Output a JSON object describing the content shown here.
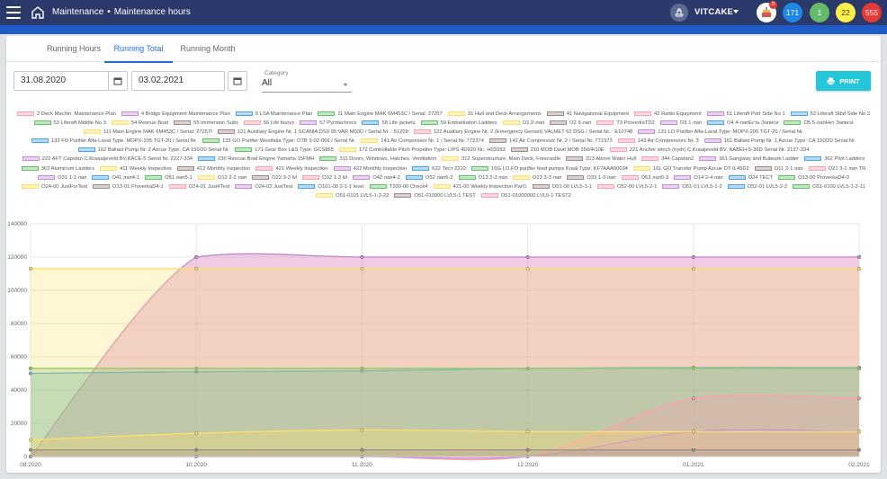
{
  "header": {
    "breadcrumb_section": "Maintenance",
    "breadcrumb_separator": "•",
    "breadcrumb_page": "Maintenance hours",
    "username": "VITCAKE",
    "notification_count": "0",
    "badge_blue": "171",
    "badge_green": "1",
    "badge_yellow": "22",
    "badge_red": "555"
  },
  "tabs": [
    "Running Hours",
    "Running Total",
    "Running Month"
  ],
  "active_tab": "Running Total",
  "filters": {
    "date_from": "31.08.2020",
    "date_to": "03.02.2021",
    "category_label": "Category",
    "category_value": "All",
    "print_label": "PRINT"
  },
  "colors": {
    "topbar": "#2b3a6b",
    "accent": "#1e6fd0",
    "print": "#26c6da"
  },
  "chart_data": {
    "type": "area",
    "x": [
      "08.2020",
      "10.2020",
      "11.2020",
      "12.2020",
      "01.2021",
      "02.2021"
    ],
    "ylim": [
      0,
      140000
    ],
    "yticks": [
      0,
      20000,
      40000,
      60000,
      80000,
      100000,
      120000,
      140000
    ],
    "grid": true,
    "legend_position": "top",
    "series_values": [
      {
        "name": "2 Deck Machin. Maintenance Plan",
        "color": "#ff9fb0",
        "values": [
          0,
          120000,
          120000,
          120000,
          120000,
          120000
        ]
      },
      {
        "name": "4 Bridge Equipment Maintenance Plan",
        "color": "#c58fd6",
        "values": [
          0,
          120000,
          120000,
          120000,
          120000,
          120000
        ]
      },
      {
        "name": "5 LSA Maintenance Plan",
        "color": "#4aa3f0",
        "values": [
          50000,
          51000,
          51500,
          53000,
          53500,
          53500
        ]
      },
      {
        "name": "11 Main Engine MAK 6M453C / Serial: 27257",
        "color": "#66c26a",
        "values": [
          53000,
          53000,
          53000,
          53000,
          53000,
          53000
        ]
      },
      {
        "name": "31 Hull and Deck Arrangements",
        "color": "#ffe066",
        "values": [
          113000,
          113000,
          113000,
          113000,
          113000,
          113000
        ]
      },
      {
        "name": "42 Radio Equipment",
        "color": "#ff9fb0",
        "values": [
          0,
          0,
          0,
          0,
          35000,
          35000
        ]
      },
      {
        "name": "51 Liferaft Port Side No 1",
        "color": "#c58fd6",
        "values": [
          0,
          0,
          0,
          0,
          15000,
          15000
        ]
      },
      {
        "name": "172 Controllable Pitch Propeller",
        "color": "#ffe066",
        "values": [
          10000,
          14000,
          16000,
          15000,
          15000,
          15000
        ]
      },
      {
        "name": "O1 2-1 лап",
        "color": "#9e8c86",
        "values": [
          4000,
          4000,
          4000,
          4000,
          4000,
          4000
        ]
      }
    ],
    "legend": [
      {
        "label": "2 Deck Machin. Maintenance Plan",
        "color": "#ff9fb0"
      },
      {
        "label": "4 Bridge Equipment Maintenance Plan",
        "color": "#c58fd6"
      },
      {
        "label": "5 LSA Maintenance Plan",
        "color": "#4aa3f0"
      },
      {
        "label": "11 Main Engine MAK 6M453C / Serial: 27257",
        "color": "#66c26a"
      },
      {
        "label": "31 Hull and Deck Arrangements",
        "color": "#ffe066"
      },
      {
        "label": "41 Navigational Equipment",
        "color": "#9e8c86"
      },
      {
        "label": "42 Radio Equipment",
        "color": "#ff9fb0"
      },
      {
        "label": "51 Liferaft Port Side No 1",
        "color": "#c58fd6"
      },
      {
        "label": "52 Liferaft Stbd Side No 2",
        "color": "#4aa3f0"
      },
      {
        "label": "53 Liferaft Middle No 3",
        "color": "#66c26a"
      },
      {
        "label": "54 Rescue Boat",
        "color": "#ffe066"
      },
      {
        "label": "55 Immersion Suits",
        "color": "#9e8c86"
      },
      {
        "label": "56 Life buoys",
        "color": "#ff9fb0"
      },
      {
        "label": "57 Pyrotechnics",
        "color": "#c58fd6"
      },
      {
        "label": "58 Life jackets",
        "color": "#4aa3f0"
      },
      {
        "label": "59 Embarkation Ladders",
        "color": "#66c26a"
      },
      {
        "label": "O1.2-лап",
        "color": "#ffe066"
      },
      {
        "label": "O2 3-лап",
        "color": "#9e8c86"
      },
      {
        "label": "T3 ProverkaTD2",
        "color": "#ff9fb0"
      },
      {
        "label": "O3 1-лап",
        "color": "#c58fd6"
      },
      {
        "label": "O4 4-лапЕсть Записи",
        "color": "#4aa3f0"
      },
      {
        "label": "O5 5-лапНет Записи",
        "color": "#66c26a"
      },
      {
        "label": "111 Main Engine MAK 6M453C / Serial: 27257f",
        "color": "#ffe066"
      },
      {
        "label": "121 Auxiliary Engine Nr. 1 SCANIA DS9 95 VAR M03D / Serial Nr. : 51209",
        "color": "#9e8c86"
      },
      {
        "label": "122 Auxiliary Engine Nr. 2 (Emergency Genset) VALMET 62 DSG / Serial Nr. : E10748",
        "color": "#ff9fb0"
      },
      {
        "label": "131 LO Purifier Alfa-Laval Type: MOPX-205 TGT-20 / Serial Nr.",
        "color": "#c58fd6"
      },
      {
        "label": "132 FO Purifier Alfa-Laval Type: MOPX-205 TGT-20 / Serial Nr.",
        "color": "#4aa3f0"
      },
      {
        "label": "133 GO Purifier Westfalia Type: OTB 3-02-066 / Serial Nr.",
        "color": "#66c26a"
      },
      {
        "label": "141 Air Compressor Nr. 1 / Serial Nr. 772374",
        "color": "#ffe066"
      },
      {
        "label": "142 Air Compressor Nr. 2 / Serial Nr. 772373",
        "color": "#9e8c86"
      },
      {
        "label": "143 Air Compressors Nr. 3",
        "color": "#ff9fb0"
      },
      {
        "label": "161 Ballast Pump Nr. 1 Azcue Type: CA 150/20 Serial Nr.",
        "color": "#c58fd6"
      },
      {
        "label": "162 Ballast Pump Nr. 2 Azcue Type: CA 150/20 Serial Nr.",
        "color": "#4aa3f0"
      },
      {
        "label": "171 Gear Box L&S Type: GCS865",
        "color": "#66c26a"
      },
      {
        "label": "172 Controllable Pitch Propeller Type: LIPS 4D920 Nr.: H03393",
        "color": "#ffe066"
      },
      {
        "label": "210 MOB Davit MOB 350/4/10E",
        "color": "#9e8c86"
      },
      {
        "label": "221 Anchor winch (hydr) C.Kraaijeveld BV, KABEH-5-36D Serial Nr. 2137-334",
        "color": "#ff9fb0"
      },
      {
        "label": "222 AFT Capstan C.Kraaaijeveld BV,KACE-5 Serial Nr. 2227-334",
        "color": "#c58fd6"
      },
      {
        "label": "230 Rescue Boat Engine Yamaha 15FMH",
        "color": "#4aa3f0"
      },
      {
        "label": "311 Doors, Windows, Hatches, Ventilation",
        "color": "#66c26a"
      },
      {
        "label": "312 Superstructure, Main Deck, Forecastle",
        "color": "#ffe066"
      },
      {
        "label": "313 Above Water Hull",
        "color": "#9e8c86"
      },
      {
        "label": "344 Capstan2",
        "color": "#ff9fb0"
      },
      {
        "label": "361 Gangway and Bulwark Ladder",
        "color": "#c58fd6"
      },
      {
        "label": "362 Pilot Ladders",
        "color": "#4aa3f0"
      },
      {
        "label": "363 Aluminum Ladders",
        "color": "#66c26a"
      },
      {
        "label": "411 Weekly Inspection",
        "color": "#ffe066"
      },
      {
        "label": "412 Monthly Inspection",
        "color": "#9e8c86"
      },
      {
        "label": "421 Weekly Inspection",
        "color": "#ff9fb0"
      },
      {
        "label": "422 Monthly Inspection",
        "color": "#c58fd6"
      },
      {
        "label": "622 Тест 2222",
        "color": "#4aa3f0"
      },
      {
        "label": "16G LO,FO purifier feed pumps Kraal Type: KF7AAA00034",
        "color": "#66c26a"
      },
      {
        "label": "16L GO Transfer Pump Azcue DT-IL45D2",
        "color": "#ffe066"
      },
      {
        "label": "O11 2-1 лап",
        "color": "#9e8c86"
      },
      {
        "label": "O21 3-1 лап TR",
        "color": "#ff9fb0"
      },
      {
        "label": "O31 1-1 лап",
        "color": "#c58fd6"
      },
      {
        "label": "O41 лап4-1",
        "color": "#4aa3f0"
      },
      {
        "label": "O51 лап5-1",
        "color": "#66c26a"
      },
      {
        "label": "O12 2-2 лап",
        "color": "#ffe066"
      },
      {
        "label": "O22 3-2 lvl",
        "color": "#9e8c86"
      },
      {
        "label": "O32 1-2 lvl",
        "color": "#ff9fb0"
      },
      {
        "label": "O42 лап4-2",
        "color": "#c58fd6"
      },
      {
        "label": "O52 лап5-2",
        "color": "#4aa3f0"
      },
      {
        "label": "O13 2-3 лап",
        "color": "#66c26a"
      },
      {
        "label": "O23 3-3 лап",
        "color": "#ffe066"
      },
      {
        "label": "O33 1-3 лап",
        "color": "#9e8c86"
      },
      {
        "label": "O53 лап5-3",
        "color": "#ff9fb0"
      },
      {
        "label": "O14 2-4 лап",
        "color": "#c58fd6"
      },
      {
        "label": "O24 TECT",
        "color": "#4aa3f0"
      },
      {
        "label": "O13-00 ProverkaD4-0",
        "color": "#66c26a"
      },
      {
        "label": "O24-00 JustForTest",
        "color": "#ffe066"
      },
      {
        "label": "O13-01 ProverkaD4-1",
        "color": "#9e8c86"
      },
      {
        "label": "O24-01 Just4Test",
        "color": "#ff9fb0"
      },
      {
        "label": "O24-02 JustTest",
        "color": "#c58fd6"
      },
      {
        "label": "O101-00 2-1-1 level",
        "color": "#4aa3f0"
      },
      {
        "label": "T200-00 Check4",
        "color": "#66c26a"
      },
      {
        "label": "421-00 Weekly Inspection Part1",
        "color": "#ffe066"
      },
      {
        "label": "O51-00 LVL5-1-1",
        "color": "#9e8c86"
      },
      {
        "label": "O52-00 LVL5-2-1",
        "color": "#ff9fb0"
      },
      {
        "label": "O51-01 LVL5-1-2",
        "color": "#c58fd6"
      },
      {
        "label": "O52-01 LVL5-2-2",
        "color": "#4aa3f0"
      },
      {
        "label": "O51-0100 LVL5-1-2-11",
        "color": "#66c26a"
      },
      {
        "label": "O51-0101 LVL5-1-2-22",
        "color": "#ffe066"
      },
      {
        "label": "O51-010000 LVL5-1 TEST",
        "color": "#9e8c86"
      },
      {
        "label": "O51-01000000 LVL5-1 TEST2",
        "color": "#ff9fb0"
      }
    ]
  }
}
